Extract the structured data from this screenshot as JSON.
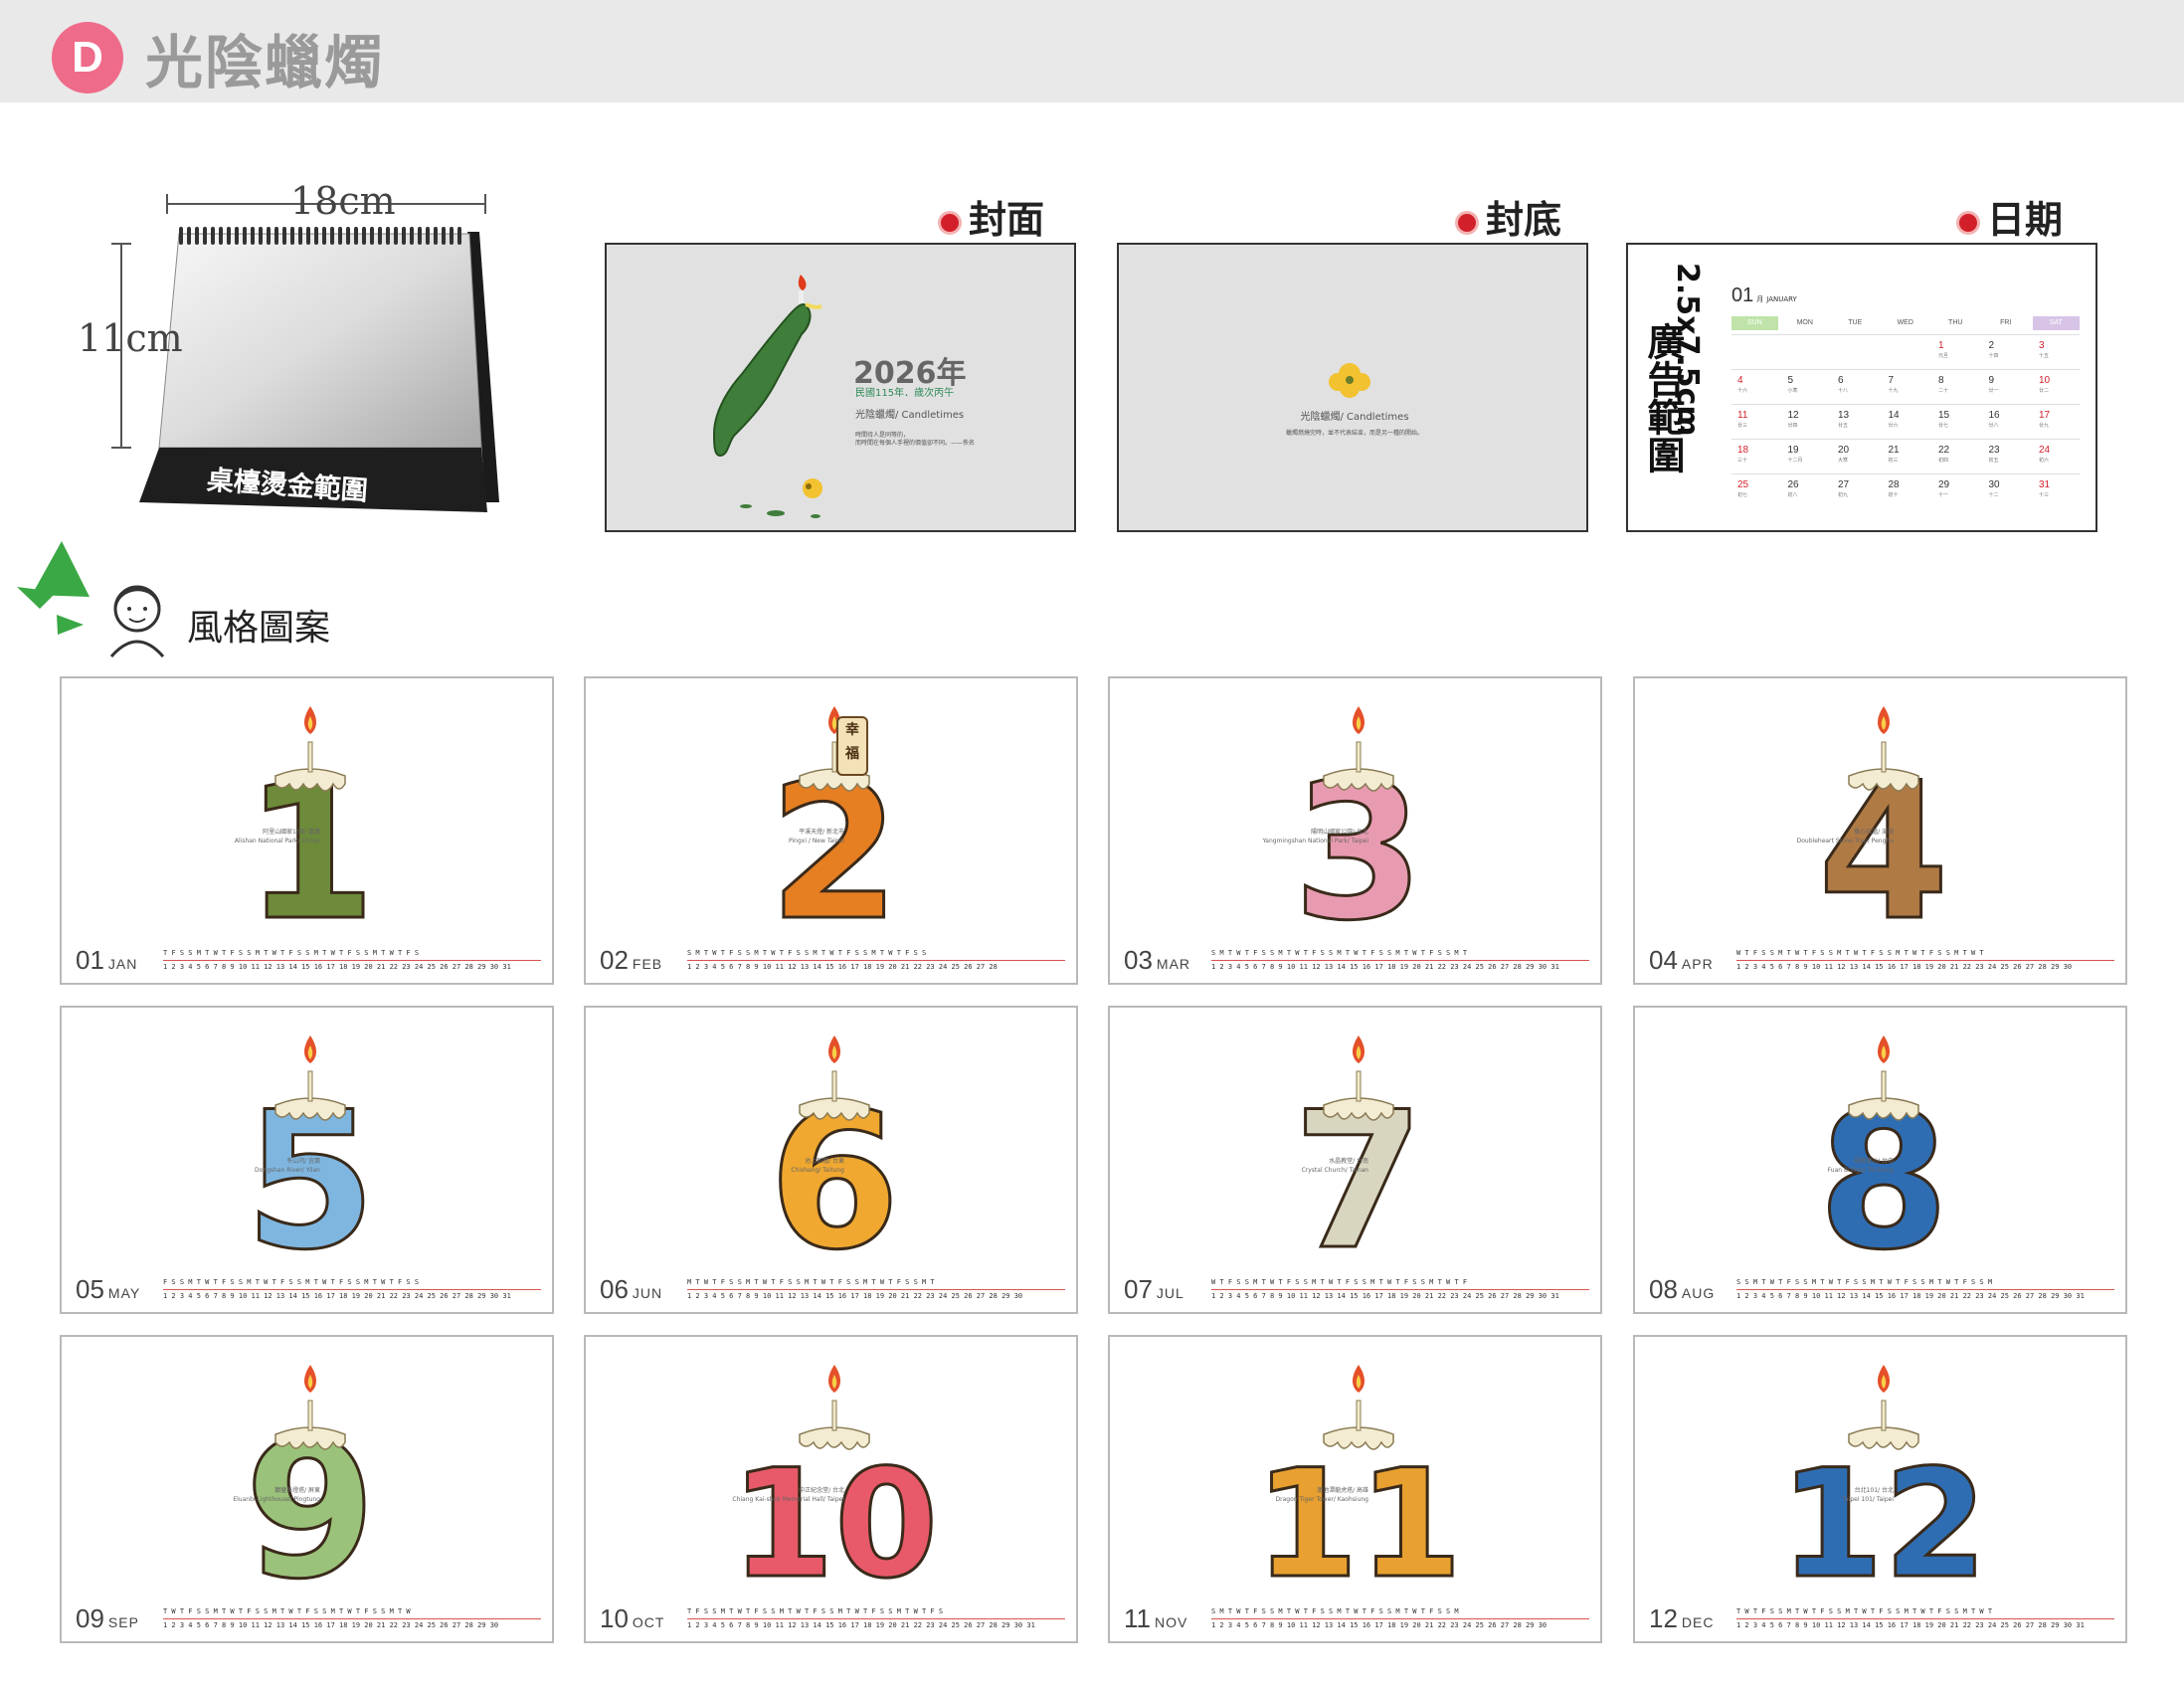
{
  "header": {
    "badge": "D",
    "title": "光陰蠟燭"
  },
  "easel": {
    "width_label": "18cm",
    "height_label": "11cm",
    "band_text": "桌檯燙金範圍"
  },
  "previews": {
    "cover": {
      "label": "封面",
      "year": "2026年",
      "sub": "民國115年．歲次丙午",
      "brand": "光陰蠟燭/ Candletimes",
      "quote1": "時間待人是同等的，",
      "quote2": "而時間在每個人手裡的價值卻不同。——佚名"
    },
    "back": {
      "label": "封底",
      "brand": "光陰蠟燭/ Candletimes",
      "quote": "蠟燭燃燒完時，並不代表結束，而是另一種的開始。"
    },
    "date": {
      "label": "日期",
      "vertical_size": "2.5x7.5cm",
      "vertical_text": "廣告範圍",
      "month_num": "01",
      "month_cn": "月",
      "month_en": "JANUARY",
      "weekdays": [
        "SUN",
        "MON",
        "TUE",
        "WED",
        "THU",
        "FRI",
        "SAT"
      ],
      "weeks": [
        [
          "",
          "",
          "",
          "",
          "1",
          "2",
          "3"
        ],
        [
          "4",
          "5",
          "6",
          "7",
          "8",
          "9",
          "10"
        ],
        [
          "11",
          "12",
          "13",
          "14",
          "15",
          "16",
          "17"
        ],
        [
          "18",
          "19",
          "20",
          "21",
          "22",
          "23",
          "24"
        ],
        [
          "25",
          "26",
          "27",
          "28",
          "29",
          "30",
          "31"
        ]
      ],
      "lunar": [
        [
          "",
          "",
          "",
          "",
          "元旦",
          "十四",
          "十五"
        ],
        [
          "十六",
          "小寒",
          "十八",
          "十九",
          "二十",
          "廿一",
          "廿二"
        ],
        [
          "廿三",
          "廿四",
          "廿五",
          "廿六",
          "廿七",
          "廿八",
          "廿九"
        ],
        [
          "三十",
          "十二月",
          "大寒",
          "初三",
          "初四",
          "初五",
          "初六"
        ],
        [
          "初七",
          "初八",
          "初九",
          "初十",
          "十一",
          "十二",
          "十三"
        ]
      ]
    }
  },
  "style_section": {
    "label": "風格圖案"
  },
  "months": [
    {
      "num": "01",
      "name": "JAN",
      "caption1": "阿里山國家公園/ 嘉義",
      "caption2": "Alishan National Park/ Chiayi",
      "digit": "1"
    },
    {
      "num": "02",
      "name": "FEB",
      "caption1": "平溪天燈/ 新北市",
      "caption2": "Pingxi / New Taipei",
      "digit": "2",
      "lantern1": "幸",
      "lantern2": "福"
    },
    {
      "num": "03",
      "name": "MAR",
      "caption1": "陽明山國家公園/ 台北",
      "caption2": "Yangmingshan National Park/ Taipei",
      "digit": "3"
    },
    {
      "num": "04",
      "name": "APR",
      "caption1": "雙心石滬/ 澎湖",
      "caption2": "Doubleheart Stone Trap/ Penghu",
      "digit": "4"
    },
    {
      "num": "05",
      "name": "MAY",
      "caption1": "冬山河/ 宜蘭",
      "caption2": "Dongshan River/ Yilan",
      "digit": "5"
    },
    {
      "num": "06",
      "name": "JUN",
      "caption1": "池上稻穗/ 台東",
      "caption2": "Chishang/ Taitung",
      "digit": "6"
    },
    {
      "num": "07",
      "name": "JUL",
      "caption1": "水晶教堂/ 台南",
      "caption2": "Crystal Church/ Tainan",
      "digit": "7"
    },
    {
      "num": "08",
      "name": "AUG",
      "caption1": "福爾摩沙/ 台中",
      "caption2": "Fuan Bridge/ Taichung",
      "digit": "8"
    },
    {
      "num": "09",
      "name": "SEP",
      "caption1": "鵝鑾鼻燈塔/ 屏東",
      "caption2": "Eluanbi Lighthouse/ Pingtung",
      "digit": "9"
    },
    {
      "num": "10",
      "name": "OCT",
      "caption1": "中正紀念堂/ 台北",
      "caption2": "Chiang Kai-shek Memorial Hall/ Taipei",
      "digit": "10"
    },
    {
      "num": "11",
      "name": "NOV",
      "caption1": "蓮池潭龍虎塔/ 高雄",
      "caption2": "Dragon Tiger Tower/ Kaohsiung",
      "digit": "11"
    },
    {
      "num": "12",
      "name": "DEC",
      "caption1": "台北101/ 台北",
      "caption2": "Taipei 101/ Taipei",
      "digit": "12"
    }
  ],
  "month_strips": [
    {
      "dow": "T F S S M T W T F S S M T W T F S S M T W T F S S M T W T F S",
      "dates": "1 2 3 4 5 6 7 8 9 10 11 12 13 14 15 16 17 18 19 20 21 22 23 24 25 26 27 28 29 30 31"
    },
    {
      "dow": "S M T W T F S S M T W T F S S M T W T F S S M T W T F S S",
      "dates": "1 2 3 4 5 6 7 8 9 10 11 12 13 14 15 16 17 18 19 20 21 22 23 24 25 26 27 28"
    },
    {
      "dow": "S M T W T F S S M T W T F S S M T W T F S S M T W T F S S M T",
      "dates": "1 2 3 4 5 6 7 8 9 10 11 12 13 14 15 16 17 18 19 20 21 22 23 24 25 26 27 28 29 30 31"
    },
    {
      "dow": "W T F S S M T W T F S S M T W T F S S M T W T F S S M T W T",
      "dates": "1 2 3 4 5 6 7 8 9 10 11 12 13 14 15 16 17 18 19 20 21 22 23 24 25 26 27 28 29 30"
    },
    {
      "dow": "F S S M T W T F S S M T W T F S S M T W T F S S M T W T F S S",
      "dates": "1 2 3 4 5 6 7 8 9 10 11 12 13 14 15 16 17 18 19 20 21 22 23 24 25 26 27 28 29 30 31"
    },
    {
      "dow": "M T W T F S S M T W T F S S M T W T F S S M T W T F S S M T",
      "dates": "1 2 3 4 5 6 7 8 9 10 11 12 13 14 15 16 17 18 19 20 21 22 23 24 25 26 27 28 29 30"
    },
    {
      "dow": "W T F S S M T W T F S S M T W T F S S M T W T F S S M T W T F",
      "dates": "1 2 3 4 5 6 7 8 9 10 11 12 13 14 15 16 17 18 19 20 21 22 23 24 25 26 27 28 29 30 31"
    },
    {
      "dow": "S S M T W T F S S M T W T F S S M T W T F S S M T W T F S S M",
      "dates": "1 2 3 4 5 6 7 8 9 10 11 12 13 14 15 16 17 18 19 20 21 22 23 24 25 26 27 28 29 30 31"
    },
    {
      "dow": "T W T F S S M T W T F S S M T W T F S S M T W T F S S M T W",
      "dates": "1 2 3 4 5 6 7 8 9 10 11 12 13 14 15 16 17 18 19 20 21 22 23 24 25 26 27 28 29 30"
    },
    {
      "dow": "T F S S M T W T F S S M T W T F S S M T W T F S S M T W T F S",
      "dates": "1 2 3 4 5 6 7 8 9 10 11 12 13 14 15 16 17 18 19 20 21 22 23 24 25 26 27 28 29 30 31"
    },
    {
      "dow": "S M T W T F S S M T W T F S S M T W T F S S M T W T F S S M",
      "dates": "1 2 3 4 5 6 7 8 9 10 11 12 13 14 15 16 17 18 19 20 21 22 23 24 25 26 27 28 29 30"
    },
    {
      "dow": "T W T F S S M T W T F S S M T W T F S S M T W T F S S M T W T",
      "dates": "1 2 3 4 5 6 7 8 9 10 11 12 13 14 15 16 17 18 19 20 21 22 23 24 25 26 27 28 29 30 31"
    }
  ],
  "colors": {
    "accent_red": "#d2202a",
    "badge_pink": "#ef6b8a",
    "green": "#2e8b57",
    "month_digits": [
      "#6d8b3a",
      "#e67e22",
      "#e89bb0",
      "#b07a45",
      "#7fb6e0",
      "#f0a830",
      "#d9d6c0",
      "#2f6db3",
      "#9bc27a",
      "#e85a6a",
      "#e8a030",
      "#2f6db3"
    ]
  }
}
